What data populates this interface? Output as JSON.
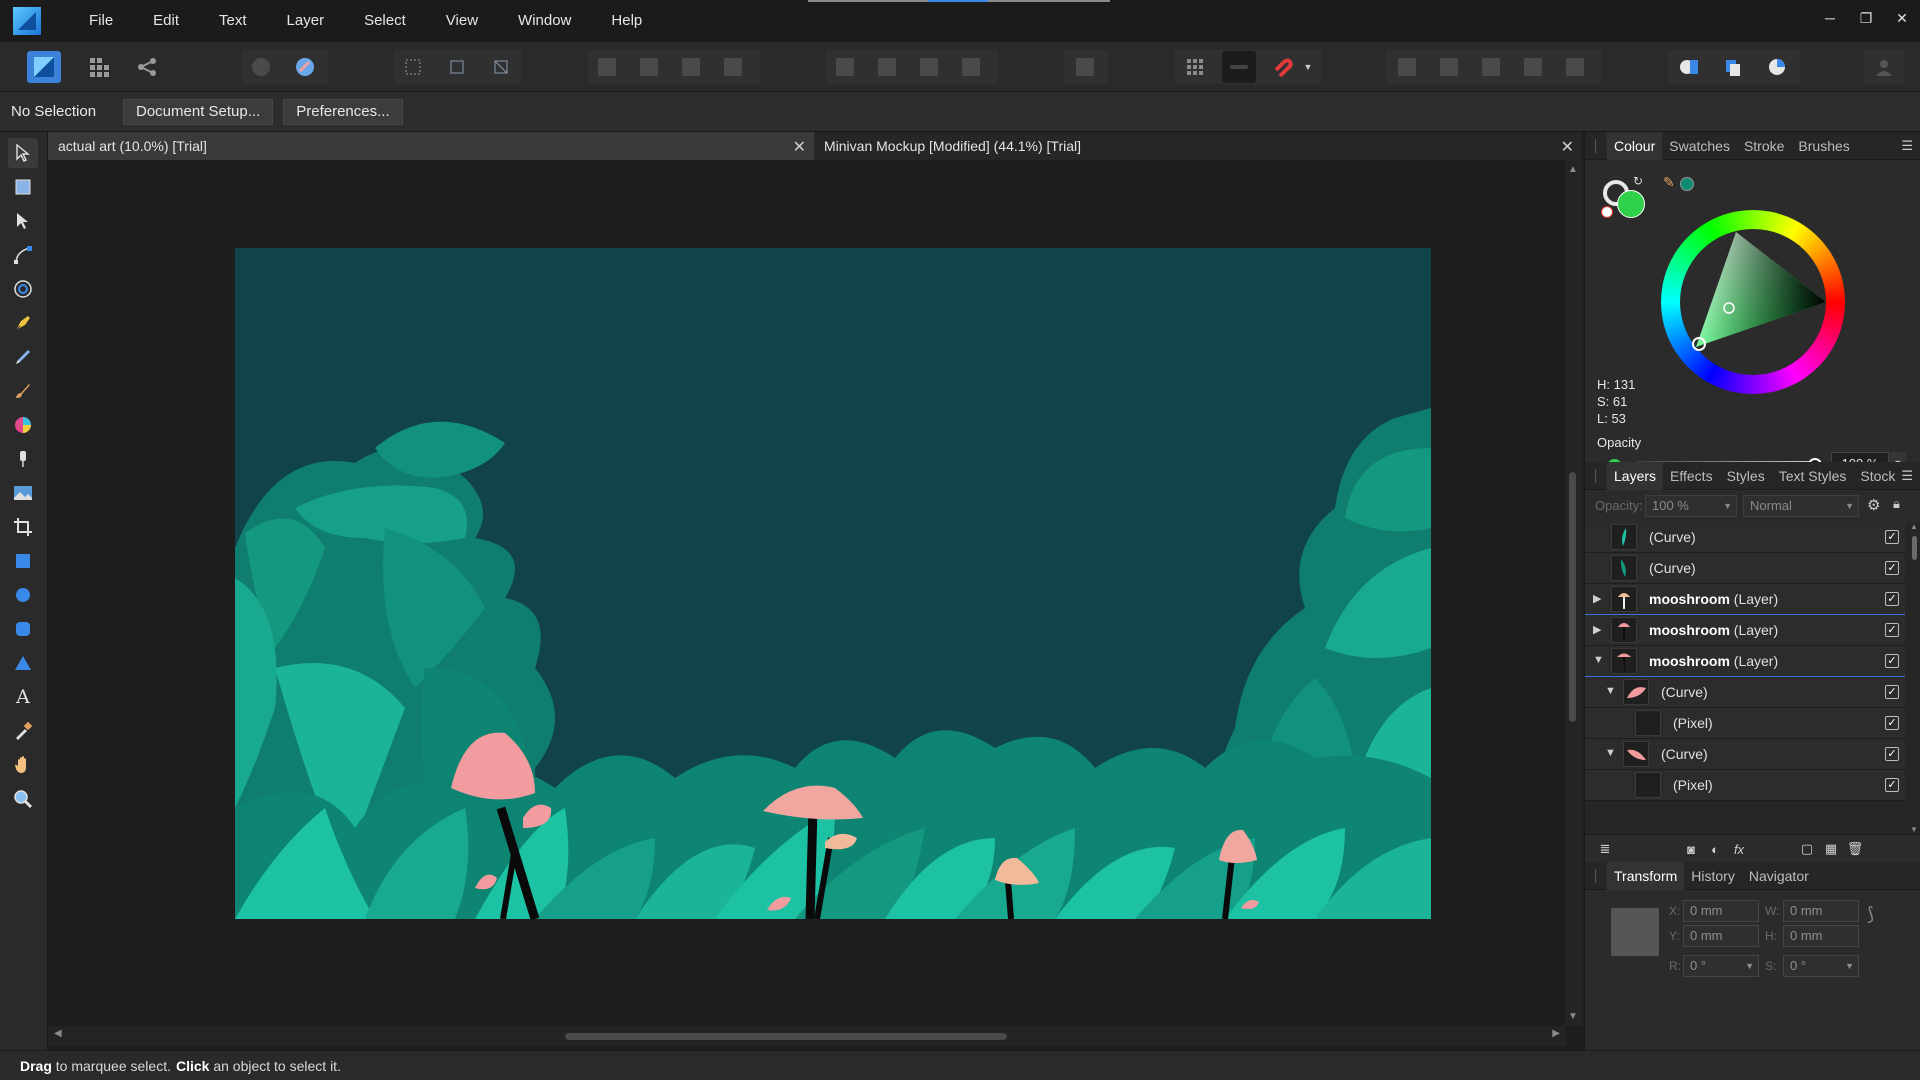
{
  "menubar": {
    "items": [
      "File",
      "Edit",
      "Text",
      "Layer",
      "Select",
      "View",
      "Window",
      "Help"
    ]
  },
  "window_controls": {
    "minimize": "─",
    "restore": "❐",
    "close": "✕"
  },
  "context": {
    "selection": "No Selection",
    "document_setup": "Document Setup...",
    "preferences": "Preferences..."
  },
  "documents": {
    "tab1": "actual art (10.0%) [Trial]",
    "tab2": "Minivan Mockup [Modified] (44.1%) [Trial]",
    "close_glyph": "✕"
  },
  "colour_panel": {
    "tabs": [
      "Colour",
      "Swatches",
      "Stroke",
      "Brushes"
    ],
    "h": "H: 131",
    "s": "S: 61",
    "l": "L: 53",
    "opacity_label": "Opacity",
    "opacity_value": "100 %",
    "fill_color": "#2fd04a",
    "accent_swatch": "#0e8a6e"
  },
  "layers_panel": {
    "tabs": [
      "Layers",
      "Effects",
      "Styles",
      "Text Styles",
      "Stock"
    ],
    "opacity_label": "Opacity:",
    "opacity_value": "100 %",
    "blend_mode": "Normal",
    "rows": [
      {
        "name": "(Curve)",
        "bold": ""
      },
      {
        "name": "(Curve)",
        "bold": ""
      },
      {
        "name": " (Layer)",
        "bold": "mooshroom"
      },
      {
        "name": " (Layer)",
        "bold": "mooshroom"
      },
      {
        "name": " (Layer)",
        "bold": "mooshroom"
      },
      {
        "name": "(Curve)",
        "bold": ""
      },
      {
        "name": "(Pixel)",
        "bold": ""
      },
      {
        "name": "(Curve)",
        "bold": ""
      },
      {
        "name": "(Pixel)",
        "bold": ""
      }
    ]
  },
  "transform_panel": {
    "tabs": [
      "Transform",
      "History",
      "Navigator"
    ],
    "x_label": "X:",
    "x_value": "0 mm",
    "y_label": "Y:",
    "y_value": "0 mm",
    "w_label": "W:",
    "w_value": "0 mm",
    "h_label": "H:",
    "h_value": "0 mm",
    "r_label": "R:",
    "r_value": "0 °",
    "s_label": "S:",
    "s_value": "0 °"
  },
  "status": {
    "drag": "Drag",
    "drag_text": "to marquee select.",
    "click": "Click",
    "click_text": "an object to select it."
  },
  "colors": {
    "artboard_bg": "#11434a",
    "foliage_dark": "#0c7a6a",
    "foliage_mid": "#14a08a",
    "foliage_light": "#1dc2a4",
    "mushroom_pink": "#f29ca0",
    "mushroom_peach": "#f2b99a"
  }
}
